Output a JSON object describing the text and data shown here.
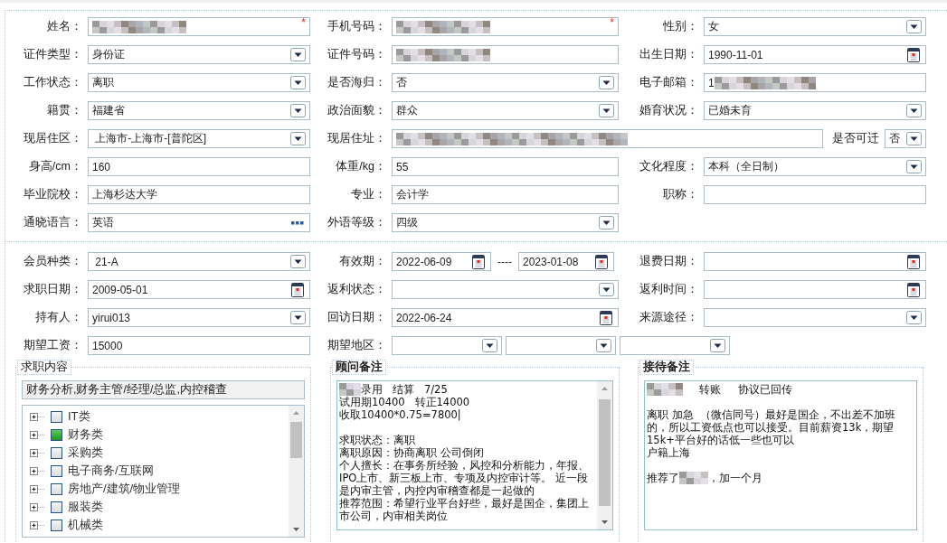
{
  "personal": {
    "rows": [
      [
        {
          "label": "姓名：",
          "kind": "text",
          "redacted": true,
          "required_mark": "*"
        },
        {
          "label": "手机号码：",
          "kind": "text",
          "redacted": true,
          "required_mark": "*"
        },
        {
          "label": "性别：",
          "kind": "select",
          "value": "女"
        }
      ],
      [
        {
          "label": "证件类型：",
          "kind": "select",
          "value": "身份证"
        },
        {
          "label": "证件号码：",
          "kind": "text",
          "redacted": true
        },
        {
          "label": "出生日期：",
          "kind": "date",
          "value": "1990-11-01"
        }
      ],
      [
        {
          "label": "工作状态：",
          "kind": "select",
          "value": "离职"
        },
        {
          "label": "是否海归：",
          "kind": "select",
          "value": "否"
        },
        {
          "label": "电子邮箱：",
          "kind": "text",
          "value": "1",
          "redacted": true
        }
      ],
      [
        {
          "label": "籍贯：",
          "kind": "select",
          "value": "福建省"
        },
        {
          "label": "政治面貌：",
          "kind": "select",
          "value": "群众"
        },
        {
          "label": "婚育状况：",
          "kind": "select",
          "value": "已婚未育"
        }
      ],
      [
        {
          "label": "现居住区：",
          "kind": "select",
          "value": " 上海市-上海市-[普陀区]"
        },
        {
          "label": "现居住址：",
          "kind": "text",
          "redacted": true,
          "inline_field": {
            "label": "是否可迁",
            "kind": "select",
            "value": "否"
          }
        }
      ],
      [
        {
          "label": "身高/cm：",
          "kind": "text",
          "value": "160"
        },
        {
          "label": "体重/kg：",
          "kind": "text",
          "value": "55"
        },
        {
          "label": "文化程度：",
          "kind": "select",
          "value": "本科（全日制）"
        }
      ],
      [
        {
          "label": "毕业院校：",
          "kind": "text",
          "value": "上海杉达大学"
        },
        {
          "label": "专业：",
          "kind": "text",
          "value": "会计学"
        },
        {
          "label": "职称：",
          "kind": "text"
        }
      ],
      [
        {
          "label": "通晓语言：",
          "kind": "lookup",
          "value": "英语"
        },
        {
          "label": "外语等级：",
          "kind": "select",
          "value": "四级"
        }
      ]
    ]
  },
  "membership": {
    "rows": [
      [
        {
          "label": "会员种类：",
          "kind": "select",
          "value": " 21-A"
        },
        {
          "label": "有效期：",
          "kind": "date_range",
          "values": [
            "2022-06-09",
            "2023-01-08"
          ],
          "separator": "----"
        },
        {
          "label": "退费日期：",
          "kind": "date"
        }
      ],
      [
        {
          "label": "求职日期：",
          "kind": "date",
          "value": "2009-05-01"
        },
        {
          "label": "返利状态：",
          "kind": "select"
        },
        {
          "label": "返利时间：",
          "kind": "date"
        }
      ],
      [
        {
          "label": "持有人：",
          "kind": "select",
          "value": "yirui013"
        },
        {
          "label": "回访日期：",
          "kind": "date",
          "value": "2022-06-24"
        },
        {
          "label": "来源途径：",
          "kind": "select"
        }
      ],
      [
        {
          "label": "期望工资：",
          "kind": "text",
          "value": "15000"
        },
        {
          "label": "期望地区：",
          "kind": "multi_select",
          "parts": [
            {
              "kind": "select"
            },
            {
              "kind": "select"
            },
            {
              "kind": "select"
            }
          ]
        }
      ]
    ]
  },
  "job_intent": {
    "title": "求职内容",
    "selected_summary": "财务分析,财务主管/经理/总监,内控稽查",
    "tree": [
      {
        "label": "IT类",
        "checked": false,
        "expanded": false
      },
      {
        "label": "财务类",
        "checked": true,
        "expanded": false
      },
      {
        "label": "采购类",
        "checked": false,
        "expanded": false
      },
      {
        "label": "电子商务/互联网",
        "checked": false,
        "expanded": false
      },
      {
        "label": "房地产/建筑/物业管理",
        "checked": false,
        "expanded": false
      },
      {
        "label": "服装类",
        "checked": false,
        "expanded": false
      },
      {
        "label": "机械类",
        "checked": false,
        "expanded": false
      }
    ]
  },
  "consultant_notes": {
    "title": "顾问备注",
    "lines": [
      {
        "kind": "text",
        "text": "录用   结算   7/25",
        "masked_start": true
      },
      {
        "kind": "text",
        "text": "试用期10400   转正14000"
      },
      {
        "kind": "text",
        "text": "收取10400*0.75=7800|"
      },
      {
        "kind": "blank"
      },
      {
        "kind": "text",
        "text": "求职状态：离职"
      },
      {
        "kind": "text",
        "text": "离职原因：协商离职 公司倒闭"
      },
      {
        "kind": "text",
        "text": "个人擅长：在事务所经验，风控和分析能力，年报、"
      },
      {
        "kind": "text",
        "text": "IPO上市、新三板上市、专项及内控审计等。 近一段"
      },
      {
        "kind": "text",
        "text": "是内审主管，内控内审稽查都是一起做的"
      },
      {
        "kind": "text",
        "text": "推荐范围：希望行业平台好些，最好是国企，集团上"
      },
      {
        "kind": "text",
        "text": "市公司，内审相关岗位"
      }
    ]
  },
  "reception_notes": {
    "title": "接待备注",
    "lines": [
      {
        "kind": "text",
        "text": "     转账     协议已回传",
        "masked_start": true
      },
      {
        "kind": "blank"
      },
      {
        "kind": "text",
        "text": "离职 加急  （微信同号）最好是国企，不出差不加班"
      },
      {
        "kind": "text",
        "text": "的，所以工资低点也可以接受。目前薪资13k，期望"
      },
      {
        "kind": "text",
        "text": "15k+平台好的话低一些也可以"
      },
      {
        "kind": "text",
        "text": "户籍上海"
      },
      {
        "kind": "blank"
      },
      {
        "kind": "text",
        "text": "推荐了",
        "masked_end": true,
        "after": "，加一个月"
      }
    ]
  }
}
